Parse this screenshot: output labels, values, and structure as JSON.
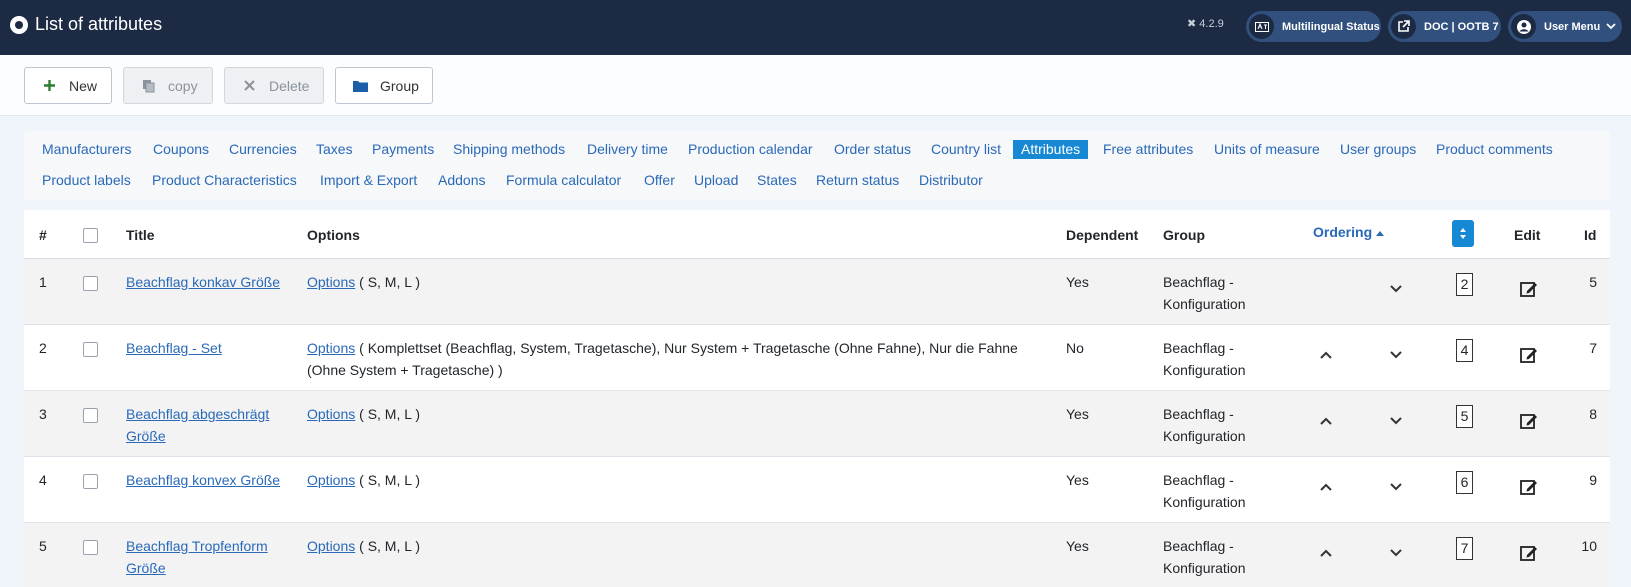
{
  "header": {
    "title": "List of attributes",
    "version": "4.2.9",
    "multilingual_label": "Multilingual Status",
    "doc_label": "DOC | OOTB 7",
    "user_menu_label": "User Menu"
  },
  "toolbar": {
    "new_label": "New",
    "copy_label": "copy",
    "delete_label": "Delete",
    "group_label": "Group"
  },
  "submenu": {
    "row1": [
      "Manufacturers",
      "Coupons",
      "Currencies",
      "Taxes",
      "Payments",
      "Shipping methods",
      "Delivery time",
      "Production calendar",
      "Order status",
      "Country list",
      "Attributes",
      "Free attributes",
      "Units of measure",
      "User groups",
      "Product comments"
    ],
    "row2": [
      "Product labels",
      "Product Characteristics",
      "Import & Export",
      "Addons",
      "Formula calculator",
      "Offer",
      "Upload",
      "States",
      "Return status",
      "Distributor"
    ],
    "active": "Attributes"
  },
  "table": {
    "headers": {
      "num": "#",
      "title": "Title",
      "options": "Options",
      "dependent": "Dependent",
      "group": "Group",
      "ordering": "Ordering",
      "edit": "Edit",
      "id": "Id"
    },
    "rows": [
      {
        "num": "1",
        "title": "Beachflag konkav Größe",
        "options_link": "Options",
        "options_text": " ( S, M, L )",
        "dependent": "Yes",
        "group": "Beachflag - Konfiguration",
        "order": "2",
        "id": "5"
      },
      {
        "num": "2",
        "title": "Beachflag - Set",
        "options_link": "Options",
        "options_text": " ( Komplettset (Beachflag, System, Tragetasche), Nur System + Tragetasche (Ohne Fahne), Nur die Fahne (Ohne System + Tragetasche) )",
        "dependent": "No",
        "group": "Beachflag - Konfiguration",
        "order": "4",
        "id": "7"
      },
      {
        "num": "3",
        "title": "Beachflag abgeschrägt Größe",
        "options_link": "Options",
        "options_text": " ( S, M, L )",
        "dependent": "Yes",
        "group": "Beachflag - Konfiguration",
        "order": "5",
        "id": "8"
      },
      {
        "num": "4",
        "title": "Beachflag konvex Größe",
        "options_link": "Options",
        "options_text": " ( S, M, L )",
        "dependent": "Yes",
        "group": "Beachflag - Konfiguration",
        "order": "6",
        "id": "9"
      },
      {
        "num": "5",
        "title": "Beachflag Tropfenform Größe",
        "options_link": "Options",
        "options_text": " ( S, M, L )",
        "dependent": "Yes",
        "group": "Beachflag - Konfiguration",
        "order": "7",
        "id": "10"
      }
    ]
  },
  "colors": {
    "header_bg": "#1c2a43",
    "accent": "#1688d4",
    "link": "#2a69b8"
  }
}
